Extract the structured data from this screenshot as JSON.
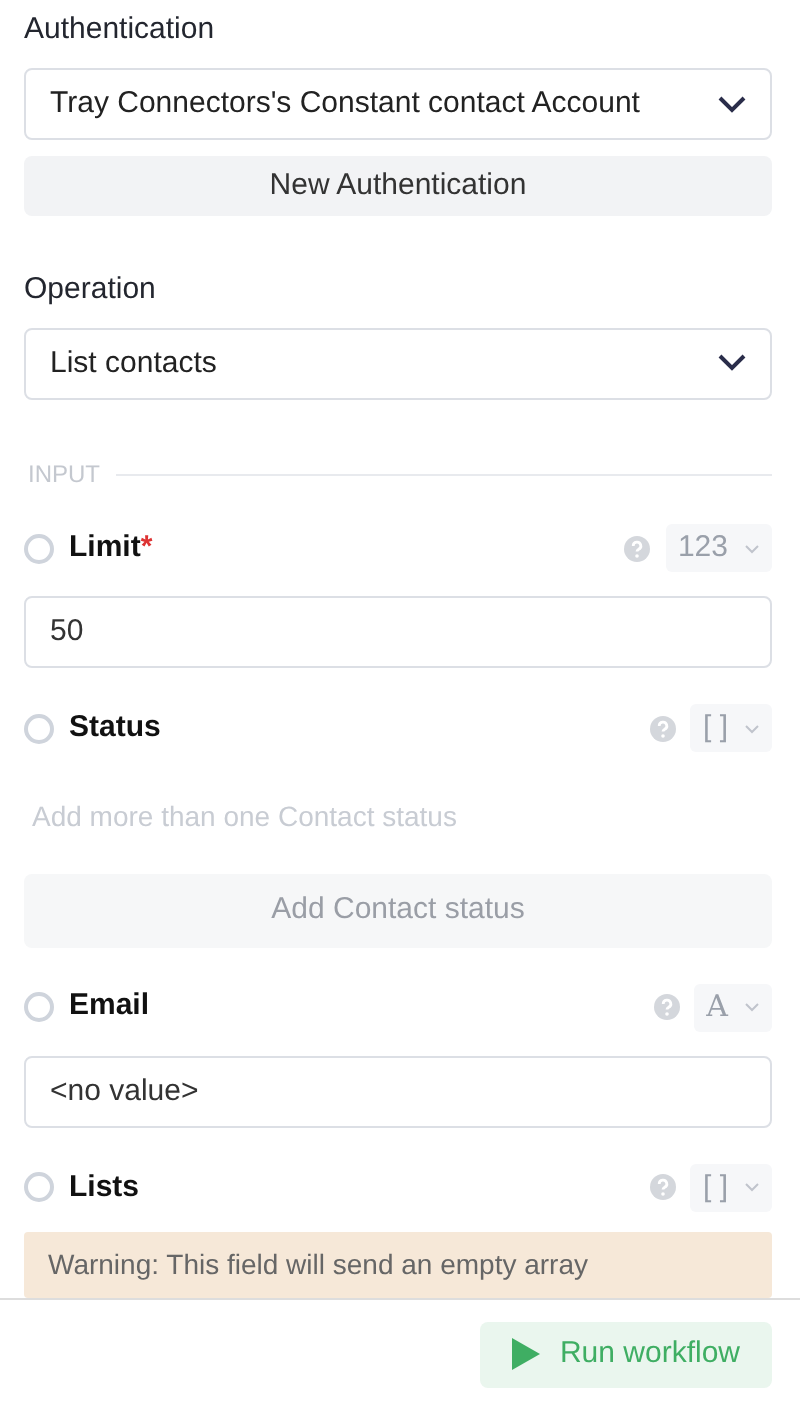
{
  "authentication": {
    "label": "Authentication",
    "selected_value": "Tray Connectors's Constant contact Account",
    "new_button": "New Authentication"
  },
  "operation": {
    "label": "Operation",
    "selected_value": "List contacts"
  },
  "input_section": {
    "heading": "INPUT"
  },
  "fields": [
    {
      "kind": "value",
      "label": "Limit",
      "required_mark": "*",
      "checked": false,
      "type_label": "123",
      "value": "50"
    },
    {
      "kind": "array",
      "label": "Status",
      "checked": false,
      "type_label": "[ ]",
      "hint": "Add more than one Contact status",
      "add_button": "Add Contact status"
    },
    {
      "kind": "value",
      "label": "Email",
      "checked": false,
      "type_label": "A",
      "value": "<no value>"
    },
    {
      "kind": "warning",
      "label": "Lists",
      "checked": false,
      "type_label": "[ ]",
      "warning": "Warning: This field will send an empty array"
    }
  ],
  "footer": {
    "run_button": "Run workflow"
  }
}
